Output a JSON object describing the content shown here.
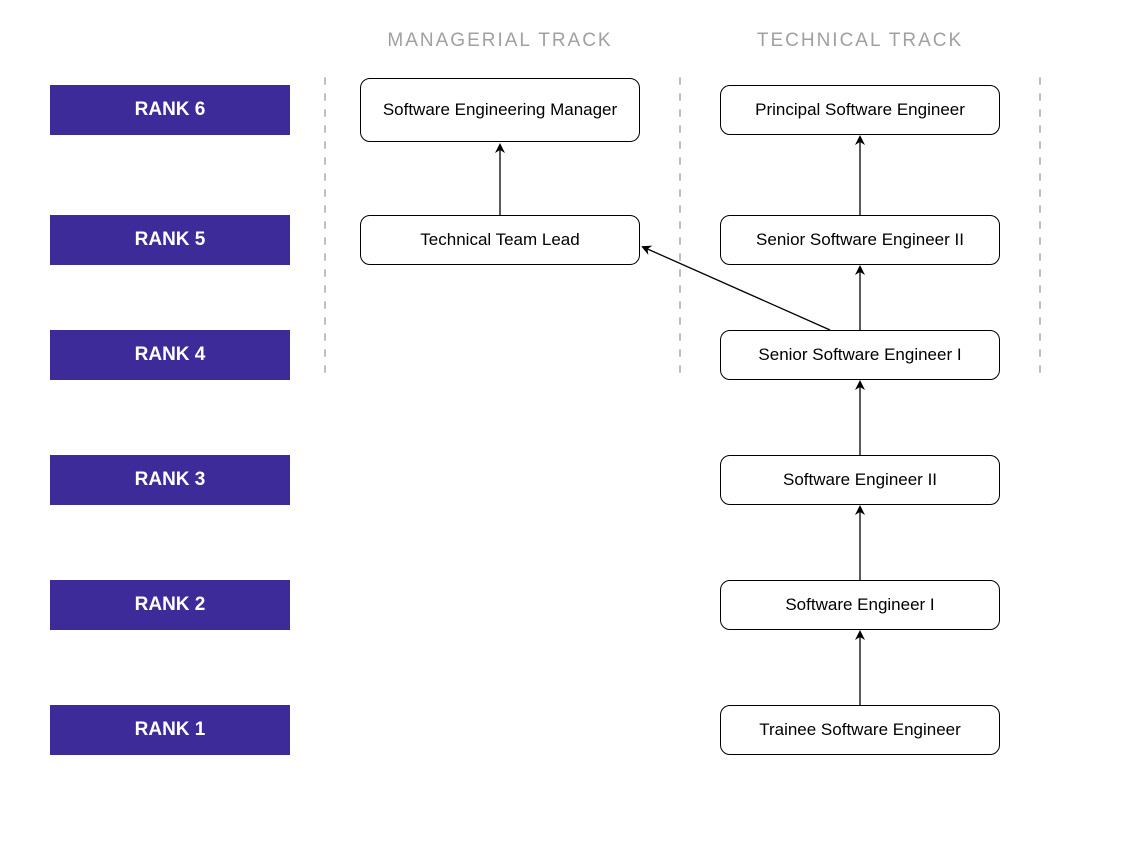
{
  "tracks": {
    "managerial": "MANAGERIAL TRACK",
    "technical": "TECHNICAL TRACK"
  },
  "ranks": {
    "r1": "RANK 1",
    "r2": "RANK 2",
    "r3": "RANK 3",
    "r4": "RANK 4",
    "r5": "RANK 5",
    "r6": "RANK 6"
  },
  "nodes": {
    "trainee": "Trainee Software Engineer",
    "se1": "Software Engineer I",
    "se2": "Software Engineer II",
    "sse1": "Senior Software Engineer I",
    "sse2": "Senior Software Engineer II",
    "principal": "Principal Software Engineer",
    "ttl": "Technical Team Lead",
    "manager": "Software Engineering Manager"
  },
  "chart_data": {
    "type": "career-ladder",
    "ranks": [
      "RANK 1",
      "RANK 2",
      "RANK 3",
      "RANK 4",
      "RANK 5",
      "RANK 6"
    ],
    "tracks": [
      "MANAGERIAL TRACK",
      "TECHNICAL TRACK"
    ],
    "positions": [
      {
        "id": "trainee",
        "label": "Trainee Software Engineer",
        "track": "TECHNICAL TRACK",
        "rank": 1
      },
      {
        "id": "se1",
        "label": "Software Engineer I",
        "track": "TECHNICAL TRACK",
        "rank": 2
      },
      {
        "id": "se2",
        "label": "Software Engineer II",
        "track": "TECHNICAL TRACK",
        "rank": 3
      },
      {
        "id": "sse1",
        "label": "Senior Software Engineer I",
        "track": "TECHNICAL TRACK",
        "rank": 4
      },
      {
        "id": "sse2",
        "label": "Senior Software Engineer II",
        "track": "TECHNICAL TRACK",
        "rank": 5
      },
      {
        "id": "principal",
        "label": "Principal Software Engineer",
        "track": "TECHNICAL TRACK",
        "rank": 6
      },
      {
        "id": "ttl",
        "label": "Technical Team Lead",
        "track": "MANAGERIAL TRACK",
        "rank": 5
      },
      {
        "id": "manager",
        "label": "Software Engineering Manager",
        "track": "MANAGERIAL TRACK",
        "rank": 6
      }
    ],
    "edges": [
      {
        "from": "trainee",
        "to": "se1"
      },
      {
        "from": "se1",
        "to": "se2"
      },
      {
        "from": "se2",
        "to": "sse1"
      },
      {
        "from": "sse1",
        "to": "sse2"
      },
      {
        "from": "sse2",
        "to": "principal"
      },
      {
        "from": "sse1",
        "to": "ttl"
      },
      {
        "from": "ttl",
        "to": "manager"
      }
    ]
  }
}
